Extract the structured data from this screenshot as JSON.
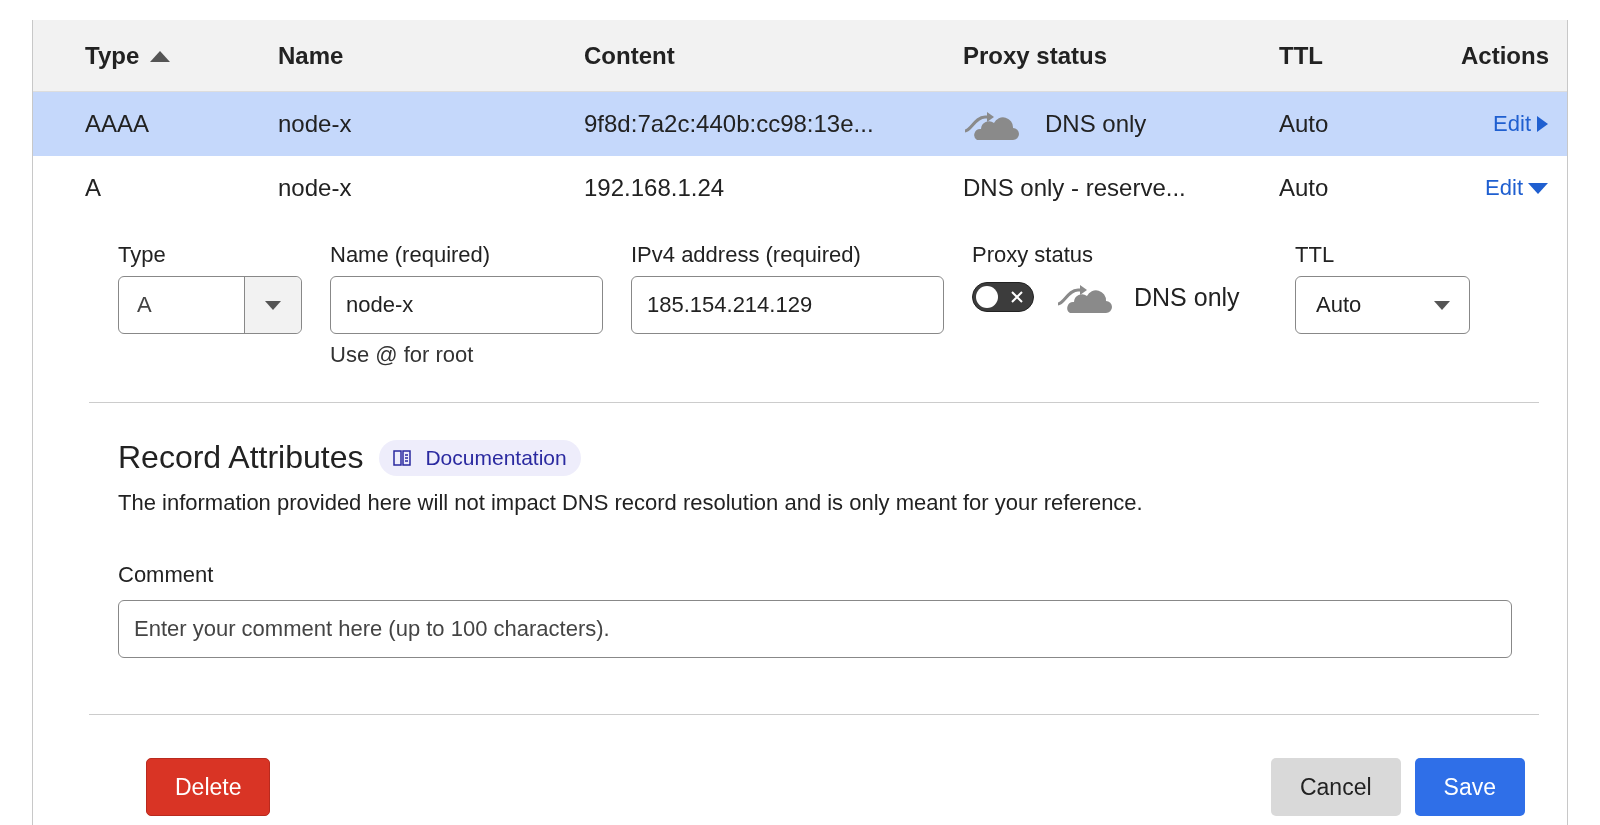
{
  "table": {
    "columns": [
      {
        "label": "Type",
        "sorted_ascending": true
      },
      {
        "label": "Name",
        "sorted_ascending": false
      },
      {
        "label": "Content",
        "sorted_ascending": false
      },
      {
        "label": "Proxy status",
        "sorted_ascending": false
      },
      {
        "label": "TTL",
        "sorted_ascending": false
      },
      {
        "label": "Actions",
        "sorted_ascending": false
      }
    ],
    "rows": [
      {
        "type": "AAAA",
        "name": "node-x",
        "content": "9f8d:7a2c:440b:cc98:13e...",
        "proxy_icon": true,
        "proxy_status": "DNS only",
        "ttl": "Auto",
        "action": "Edit",
        "selected": true,
        "expanded": false
      },
      {
        "type": "A",
        "name": "node-x",
        "content": "192.168.1.24",
        "proxy_icon": false,
        "proxy_status": "DNS only - reserve...",
        "ttl": "Auto",
        "action": "Edit",
        "selected": false,
        "expanded": true
      }
    ]
  },
  "editor": {
    "type": {
      "label": "Type",
      "value": "A"
    },
    "name": {
      "label": "Name (required)",
      "value": "node-x",
      "hint": "Use @ for root"
    },
    "address": {
      "label": "IPv4 address (required)",
      "value": "185.154.214.129"
    },
    "proxy": {
      "label": "Proxy status",
      "on": false,
      "text": "DNS only"
    },
    "ttl": {
      "label": "TTL",
      "value": "Auto"
    },
    "attributes": {
      "title": "Record Attributes",
      "doc_link": "Documentation",
      "description": "The information provided here will not impact DNS record resolution and is only meant for your reference."
    },
    "comment": {
      "label": "Comment",
      "placeholder": "Enter your comment here (up to 100 characters)."
    },
    "buttons": [
      {
        "kind": "danger",
        "label": "Delete"
      },
      {
        "kind": "secondary",
        "label": "Cancel"
      },
      {
        "kind": "primary",
        "label": "Save"
      }
    ]
  }
}
